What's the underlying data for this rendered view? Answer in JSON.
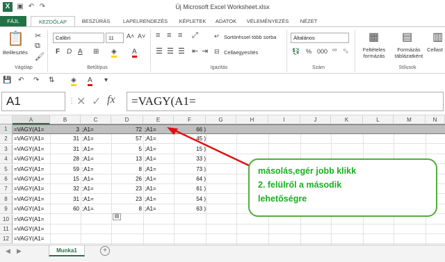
{
  "window": {
    "title": "Új Microsoft Excel Worksheet.xlsx",
    "app_logo": "X"
  },
  "tabs": [
    {
      "label": "FÁJL"
    },
    {
      "label": "KEZDŐLAP"
    },
    {
      "label": "BESZÚRÁS"
    },
    {
      "label": "LAPELRENDEZÉS"
    },
    {
      "label": "KÉPLETEK"
    },
    {
      "label": "ADATOK"
    },
    {
      "label": "VÉLEMÉNYEZÉS"
    },
    {
      "label": "NÉZET"
    }
  ],
  "ribbon": {
    "paste_label": "Beillesztés",
    "font_name": "Calibri",
    "font_size": "11",
    "wrap_text": "Sortöréssel több sorba",
    "merge_center": "Cellaegyesítés",
    "number_format": "Általános",
    "conditional_format": "Feltételes formázás",
    "format_table": "Formázás táblázatként",
    "cell_styles": "Cellast",
    "groups": {
      "clipboard": "Vágólap",
      "font": "Betűtípus",
      "alignment": "Igazítás",
      "number": "Szám",
      "styles": "Stílusok"
    }
  },
  "formula_bar": {
    "name_box": "A1",
    "formula": "=VAGY(A1=",
    "cancel": "✕",
    "enter": "✓",
    "fx": "fx"
  },
  "grid": {
    "columns": [
      "A",
      "B",
      "C",
      "D",
      "E",
      "F",
      "G",
      "H",
      "I",
      "J",
      "K",
      "L",
      "M",
      "N"
    ],
    "rows": [
      {
        "num": "1",
        "a": "=VAGY(A1=",
        "b": "3",
        "c": ";A1=",
        "d": "72",
        "e": ";A1=",
        "f": "66 )"
      },
      {
        "num": "2",
        "a": "=VAGY(A1=",
        "b": "31",
        "c": ";A1=",
        "d": "57",
        "e": ";A1=",
        "f": "45 )"
      },
      {
        "num": "3",
        "a": "=VAGY(A1=",
        "b": "31",
        "c": ";A1=",
        "d": "5",
        "e": ";A1=",
        "f": "15 )"
      },
      {
        "num": "4",
        "a": "=VAGY(A1=",
        "b": "28",
        "c": ";A1=",
        "d": "13",
        "e": ";A1=",
        "f": "33 )"
      },
      {
        "num": "5",
        "a": "=VAGY(A1=",
        "b": "59",
        "c": ";A1=",
        "d": "8",
        "e": ";A1=",
        "f": "73 )"
      },
      {
        "num": "6",
        "a": "=VAGY(A1=",
        "b": "15",
        "c": ";A1=",
        "d": "26",
        "e": ";A1=",
        "f": "64 )"
      },
      {
        "num": "7",
        "a": "=VAGY(A1=",
        "b": "32",
        "c": ";A1=",
        "d": "23",
        "e": ";A1=",
        "f": "61 )"
      },
      {
        "num": "8",
        "a": "=VAGY(A1=",
        "b": "31",
        "c": ";A1=",
        "d": "23",
        "e": ";A1=",
        "f": "54 )"
      },
      {
        "num": "9",
        "a": "=VAGY(A1=",
        "b": "60",
        "c": ";A1=",
        "d": "8",
        "e": ";A1=",
        "f": "63 )"
      },
      {
        "num": "10",
        "a": "=VAGY(A1=",
        "b": "",
        "c": "",
        "d": "",
        "e": "",
        "f": ""
      },
      {
        "num": "11",
        "a": "=VAGY(A1=",
        "b": "",
        "c": "",
        "d": "",
        "e": "",
        "f": ""
      },
      {
        "num": "12",
        "a": "=VAGY(A1=",
        "b": "",
        "c": "",
        "d": "",
        "e": "",
        "f": ""
      }
    ]
  },
  "annotation": {
    "line1": "másolás,egér jobb klikk",
    "line2": "2. felülről a második",
    "line3": "lehetőségre",
    "color": "#19b020",
    "arrow_color": "#e01010"
  },
  "sheet_tab": "Munka1"
}
